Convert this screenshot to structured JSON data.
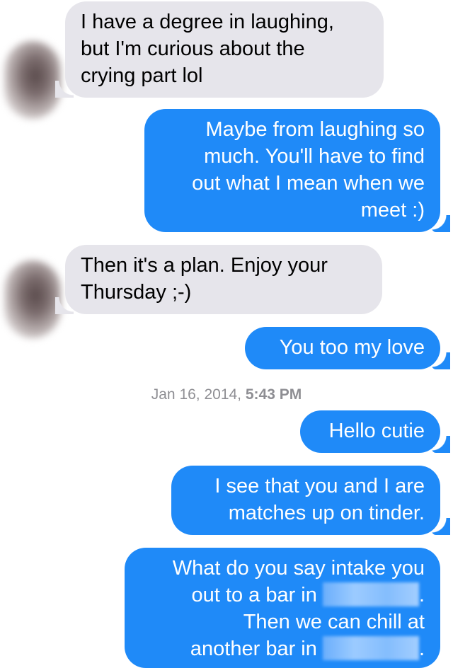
{
  "conversation": {
    "messages": [
      {
        "from": "them",
        "lines": [
          "I have a degree in laughing,",
          "but I'm curious about the",
          "crying part lol"
        ]
      },
      {
        "from": "me",
        "lines": [
          "Maybe from laughing so",
          "much. You'll have to find",
          "out what I mean when we",
          "meet :)"
        ]
      },
      {
        "from": "them",
        "lines": [
          "Then it's a plan. Enjoy your",
          "Thursday ;-)"
        ]
      },
      {
        "from": "me",
        "lines": [
          "You too my love"
        ]
      },
      {
        "from": "me",
        "lines": [
          "Hello cutie"
        ]
      },
      {
        "from": "me",
        "lines": [
          "I see that you and I are",
          "matches up on tinder."
        ]
      },
      {
        "from": "me",
        "lines": [
          "What do you say intake you",
          "out to a bar in",
          ".",
          "Then we can chill at",
          "another bar in",
          "."
        ]
      }
    ],
    "timestamp": {
      "date": "Jan 16, 2014,",
      "time": "5:43 PM"
    }
  },
  "colors": {
    "outgoing_bubble": "#1f8af8",
    "incoming_bubble": "#e6e5eb",
    "timestamp_text": "#8e8e93"
  }
}
